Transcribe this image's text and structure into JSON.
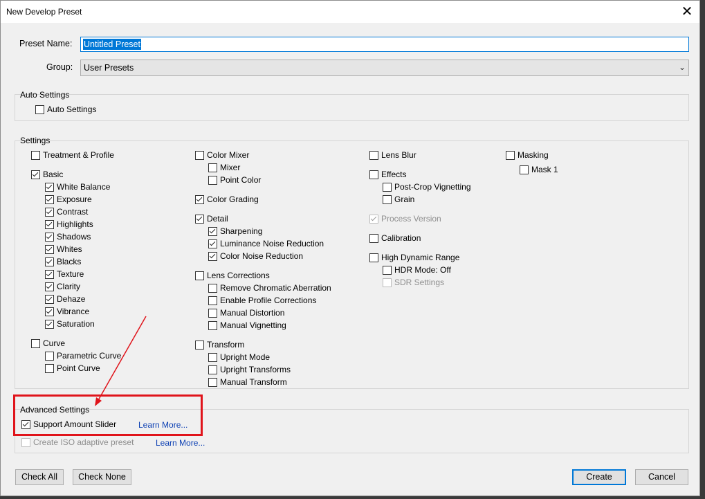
{
  "window": {
    "title": "New Develop Preset",
    "close_icon": "close-icon"
  },
  "preset_name": {
    "label": "Preset Name:",
    "value": "Untitled Preset"
  },
  "group": {
    "label": "Group:",
    "value": "User Presets"
  },
  "auto_settings": {
    "heading": "Auto Settings",
    "item": {
      "label": "Auto Settings",
      "checked": false
    }
  },
  "settings": {
    "heading": "Settings",
    "col1": {
      "treatment": "Treatment & Profile",
      "basic": "Basic",
      "white_balance": "White Balance",
      "exposure": "Exposure",
      "contrast": "Contrast",
      "highlights": "Highlights",
      "shadows": "Shadows",
      "whites": "Whites",
      "blacks": "Blacks",
      "texture": "Texture",
      "clarity": "Clarity",
      "dehaze": "Dehaze",
      "vibrance": "Vibrance",
      "saturation": "Saturation",
      "curve": "Curve",
      "parametric_curve": "Parametric Curve",
      "point_curve": "Point Curve"
    },
    "col2": {
      "color_mixer": "Color Mixer",
      "mixer": "Mixer",
      "point_color": "Point Color",
      "color_grading": "Color Grading",
      "detail": "Detail",
      "sharpening": "Sharpening",
      "luminance_noise": "Luminance Noise Reduction",
      "color_noise": "Color Noise Reduction",
      "lens_corrections": "Lens Corrections",
      "remove_ca": "Remove Chromatic Aberration",
      "profile_corrections": "Enable Profile Corrections",
      "manual_distortion": "Manual Distortion",
      "manual_vignetting": "Manual Vignetting",
      "transform": "Transform",
      "upright_mode": "Upright Mode",
      "upright_transforms": "Upright Transforms",
      "manual_transform": "Manual Transform"
    },
    "col3": {
      "lens_blur": "Lens Blur",
      "effects": "Effects",
      "post_crop": "Post-Crop Vignetting",
      "grain": "Grain",
      "process_version": "Process Version",
      "calibration": "Calibration",
      "hdr": "High Dynamic Range",
      "hdr_mode": "HDR Mode: Off",
      "sdr_settings": "SDR Settings"
    },
    "col4": {
      "masking": "Masking",
      "mask1": "Mask 1"
    }
  },
  "advanced": {
    "heading": "Advanced Settings",
    "support_amount": "Support Amount Slider",
    "learn_more_1": "Learn More...",
    "iso_adaptive": "Create ISO adaptive preset",
    "learn_more_2": "Learn More..."
  },
  "buttons": {
    "check_all": "Check All",
    "check_none": "Check None",
    "create": "Create",
    "cancel": "Cancel"
  },
  "annotation_color": "#e0141b"
}
